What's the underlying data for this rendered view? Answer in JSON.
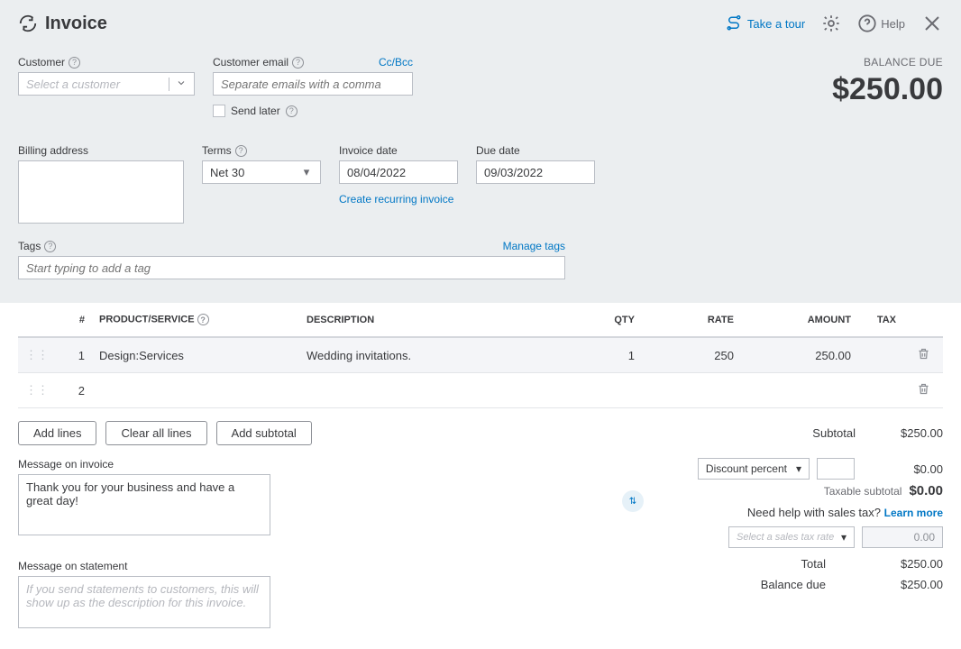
{
  "header": {
    "title": "Invoice",
    "take_tour": "Take a tour",
    "help": "Help"
  },
  "balance": {
    "label": "BALANCE DUE",
    "amount": "$250.00"
  },
  "customer": {
    "label": "Customer",
    "placeholder": "Select a customer"
  },
  "email": {
    "label": "Customer email",
    "cc_bcc": "Cc/Bcc",
    "placeholder": "Separate emails with a comma",
    "send_later": "Send later"
  },
  "billing": {
    "label": "Billing address"
  },
  "terms": {
    "label": "Terms",
    "value": "Net 30"
  },
  "invoice_date": {
    "label": "Invoice date",
    "value": "08/04/2022",
    "recurring": "Create recurring invoice"
  },
  "due_date": {
    "label": "Due date",
    "value": "09/03/2022"
  },
  "tags": {
    "label": "Tags",
    "placeholder": "Start typing to add a tag",
    "manage": "Manage tags"
  },
  "columns": {
    "num": "#",
    "product": "PRODUCT/SERVICE",
    "desc": "DESCRIPTION",
    "qty": "QTY",
    "rate": "RATE",
    "amount": "AMOUNT",
    "tax": "TAX"
  },
  "rows": [
    {
      "num": "1",
      "product": "Design:Services",
      "desc": "Wedding invitations.",
      "qty": "1",
      "rate": "250",
      "amount": "250.00"
    },
    {
      "num": "2",
      "product": "",
      "desc": "",
      "qty": "",
      "rate": "",
      "amount": ""
    }
  ],
  "buttons": {
    "add_lines": "Add lines",
    "clear_all": "Clear all lines",
    "add_subtotal": "Add subtotal"
  },
  "totals": {
    "subtotal_label": "Subtotal",
    "subtotal": "$250.00",
    "discount_label": "Discount percent",
    "discount_amount": "$0.00",
    "taxable_subtotal_label": "Taxable subtotal",
    "taxable_subtotal": "$0.00",
    "sales_tax_help": "Need help with sales tax?",
    "learn_more": "Learn more",
    "tax_placeholder": "Select a sales tax rate",
    "tax_value": "0.00",
    "total_label": "Total",
    "total": "$250.00",
    "balance_due_label": "Balance due",
    "balance_due": "$250.00"
  },
  "messages": {
    "invoice_label": "Message on invoice",
    "invoice_text": "Thank you for your business and have a great day!",
    "statement_label": "Message on statement",
    "statement_placeholder": "If you send statements to customers, this will show up as the description for this invoice."
  }
}
